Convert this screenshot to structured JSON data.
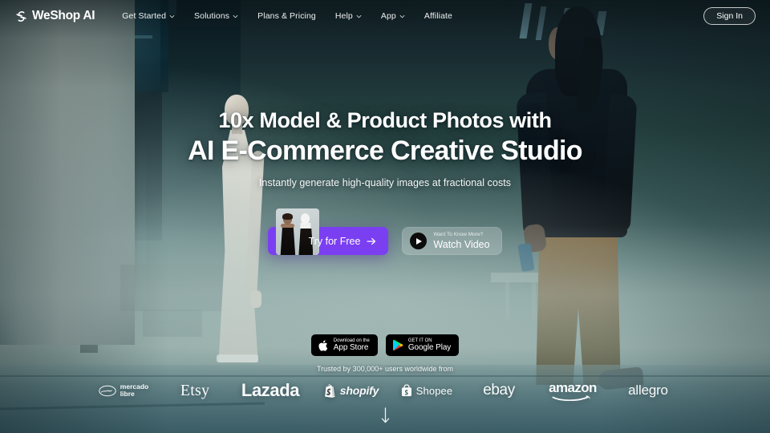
{
  "brand": {
    "name": "WeShop AI",
    "logo_icon": "weshop-monogram-icon"
  },
  "nav": {
    "items": [
      {
        "label": "Get Started",
        "has_dropdown": true
      },
      {
        "label": "Solutions",
        "has_dropdown": true
      },
      {
        "label": "Plans & Pricing",
        "has_dropdown": false
      },
      {
        "label": "Help",
        "has_dropdown": true
      },
      {
        "label": "App",
        "has_dropdown": true
      },
      {
        "label": "Affiliate",
        "has_dropdown": false
      }
    ],
    "sign_in_label": "Sign In"
  },
  "hero": {
    "headline_line1": "10x Model & Product Photos with",
    "headline_line2": "AI E-Commerce Creative Studio",
    "subheadline": "Instantly generate high-quality images at fractional costs"
  },
  "cta": {
    "primary_label": "Try for Free",
    "primary_arrow_icon": "arrow-right-icon",
    "primary_color": "#7b3ff2",
    "video_kicker": "Want To Know More?",
    "video_label": "Watch Video",
    "video_play_icon": "play-icon"
  },
  "stores": [
    {
      "small": "Download on the",
      "big": "App Store",
      "icon": "apple-icon"
    },
    {
      "small": "GET IT ON",
      "big": "Google Play",
      "icon": "google-play-icon"
    }
  ],
  "social_proof": {
    "trust_text": "Trusted by 300,000+ users worldwide from",
    "logos": [
      {
        "name": "mercado libre",
        "line1": "mercado",
        "line2": "libre"
      },
      {
        "name": "Etsy",
        "text": "Etsy"
      },
      {
        "name": "Lazada",
        "text": "Lazada"
      },
      {
        "name": "shopify",
        "text": "shopify"
      },
      {
        "name": "Shopee",
        "text": "Shopee"
      },
      {
        "name": "ebay",
        "text": "ebay"
      },
      {
        "name": "amazon",
        "text": "amazon"
      },
      {
        "name": "allegro",
        "text": "allegro"
      }
    ]
  },
  "scroll_cue": {
    "icon": "arrow-down-icon"
  }
}
